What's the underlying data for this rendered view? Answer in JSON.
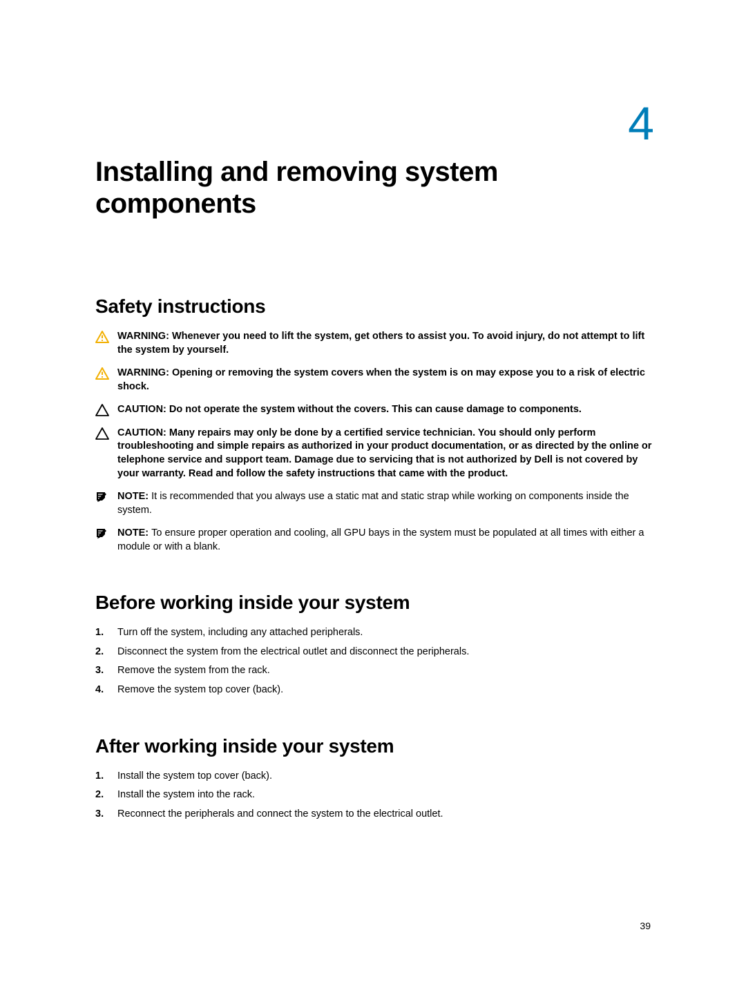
{
  "chapter": {
    "number": "4",
    "title": "Installing and removing system components"
  },
  "safety": {
    "heading": "Safety instructions",
    "items": [
      {
        "type": "warning",
        "label": "WARNING: ",
        "text": "Whenever you need to lift the system, get others to assist you. To avoid injury, do not attempt to lift the system by yourself."
      },
      {
        "type": "warning",
        "label": "WARNING: ",
        "text": "Opening or removing the system covers when the system is on may expose you to a risk of electric shock."
      },
      {
        "type": "caution",
        "label": "CAUTION: ",
        "text": "Do not operate the system without the covers. This can cause damage to components."
      },
      {
        "type": "caution",
        "label": "CAUTION: ",
        "text": "Many repairs may only be done by a certified service technician. You should only perform troubleshooting and simple repairs as authorized in your product documentation, or as directed by the online or telephone service and support team. Damage due to servicing that is not authorized by Dell is not covered by your warranty. Read and follow the safety instructions that came with the product."
      },
      {
        "type": "note",
        "label": "NOTE: ",
        "text": "It is recommended that you always use a static mat and static strap while working on components inside the system."
      },
      {
        "type": "note",
        "label": "NOTE: ",
        "text": "To ensure proper operation and cooling, all GPU bays in the system must be populated at all times with either a module or with a blank."
      }
    ]
  },
  "before": {
    "heading": "Before working inside your system",
    "steps": [
      "Turn off the system, including any attached peripherals.",
      "Disconnect the system from the electrical outlet and disconnect the peripherals.",
      "Remove the system from the rack.",
      "Remove the system top cover (back)."
    ]
  },
  "after": {
    "heading": "After working inside your system",
    "steps": [
      "Install the system top cover (back).",
      "Install the system into the rack.",
      "Reconnect the peripherals and connect the system to the electrical outlet."
    ]
  },
  "page_number": "39"
}
